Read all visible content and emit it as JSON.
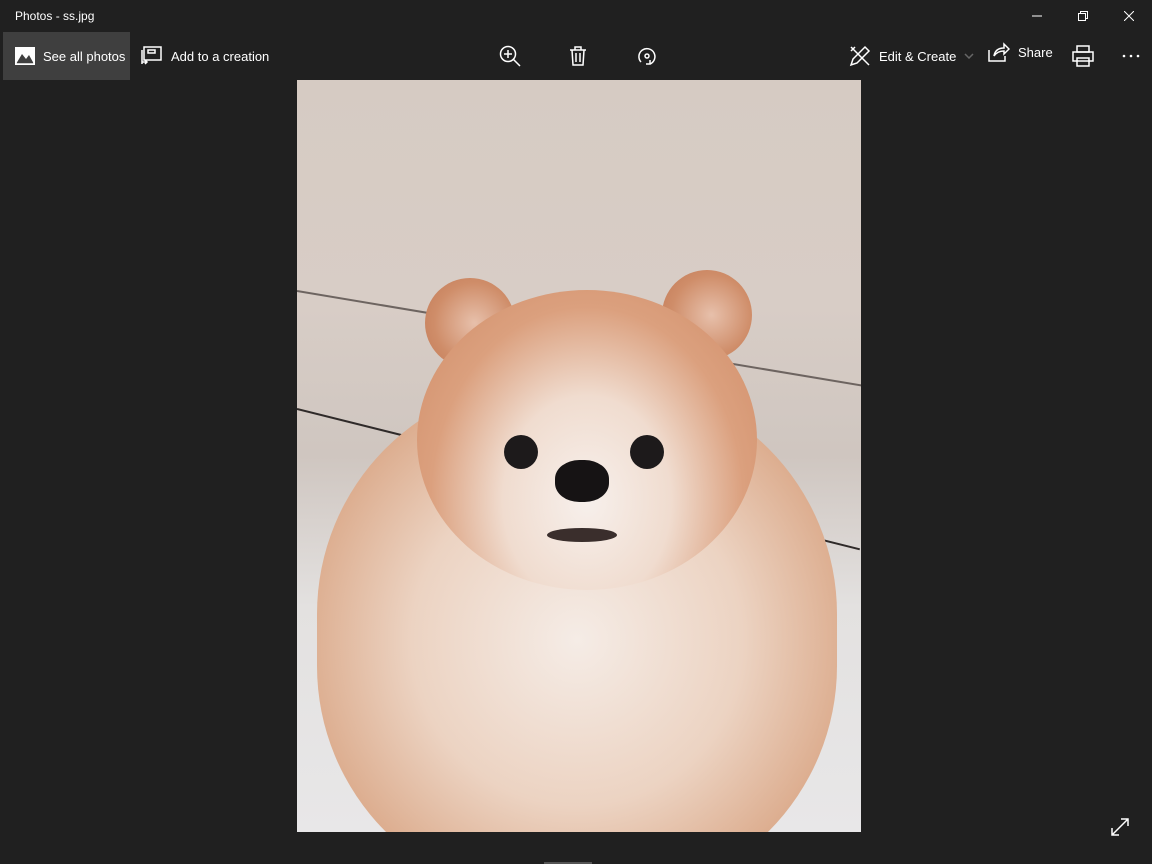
{
  "window": {
    "title": "Photos - ss.jpg"
  },
  "toolbar": {
    "see_all_photos": "See all photos",
    "add_to_creation": "Add to a creation",
    "edit_create": "Edit & Create",
    "share": "Share"
  },
  "colors": {
    "background": "#202020",
    "active_button": "#3f3f3f"
  }
}
